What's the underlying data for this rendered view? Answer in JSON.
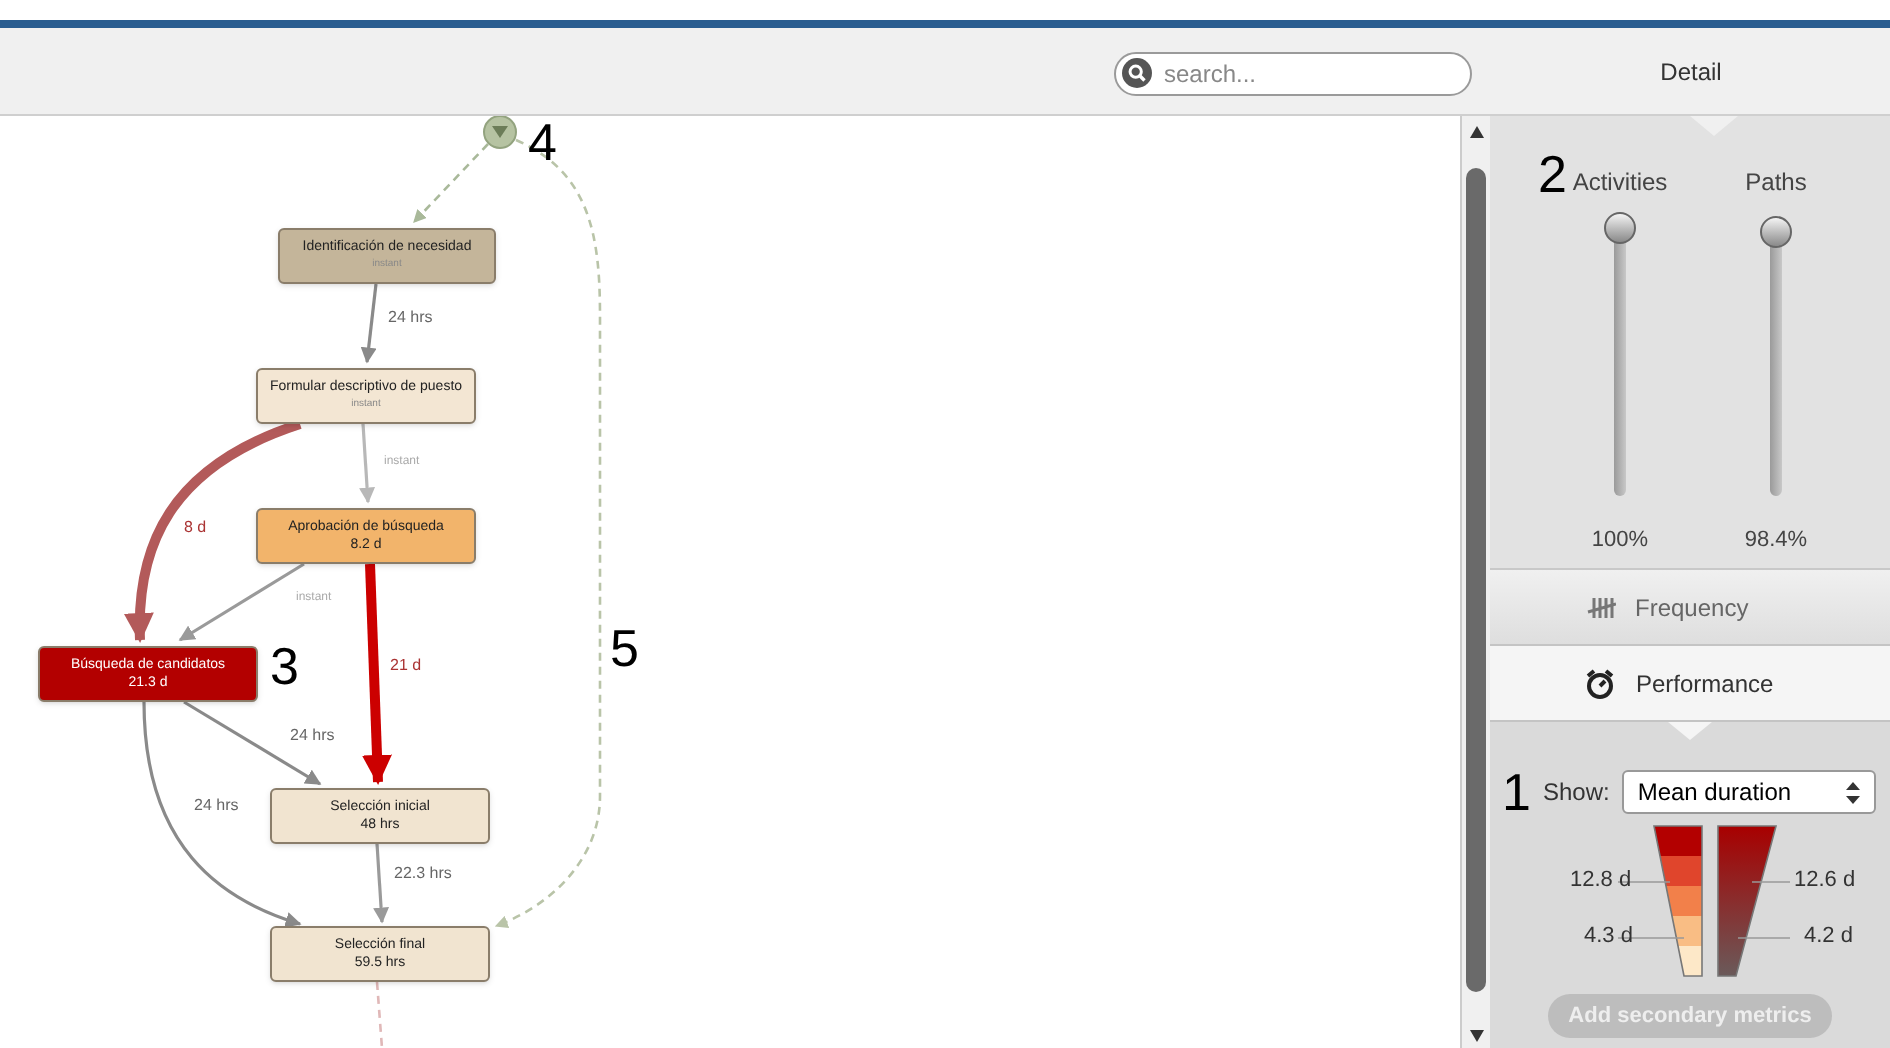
{
  "toolbar": {
    "search": {
      "placeholder": "search..."
    },
    "tabs": [
      {
        "label": "Detail",
        "selected": true
      }
    ]
  },
  "process_map": {
    "nodes": [
      {
        "name": "Identificación de necesidad",
        "metric": "instant",
        "color": "#c4b59a"
      },
      {
        "name": "Formular descriptivo de puesto",
        "metric": "instant",
        "color": "#f3e6d3"
      },
      {
        "name": "Aprobación de búsqueda",
        "metric": "8.2 d",
        "color": "#f2b46b"
      },
      {
        "name": "Búsqueda de candidatos",
        "metric": "21.3 d",
        "color": "#b30000"
      },
      {
        "name": "Selección inicial",
        "metric": "48 hrs",
        "color": "#f1e4d0"
      },
      {
        "name": "Selección final",
        "metric": "59.5 hrs",
        "color": "#f1e4d0"
      }
    ],
    "edges": [
      {
        "kind": "dashed",
        "color": "#a9b99a"
      },
      {
        "kind": "solid",
        "label": "24 hrs",
        "color": "#8a8a8a"
      },
      {
        "kind": "solid",
        "label": "instant",
        "color": "#b8b8b8"
      },
      {
        "kind": "thick",
        "label": "8 d",
        "color": "#b35a5a"
      },
      {
        "kind": "solid",
        "label": "instant",
        "color": "#9a9a9a"
      },
      {
        "kind": "thick",
        "label": "21 d",
        "color": "#cc0000"
      },
      {
        "kind": "solid",
        "label": "24 hrs",
        "color": "#8a8a8a"
      },
      {
        "kind": "solid",
        "label": "24 hrs",
        "color": "#8a8a8a"
      },
      {
        "kind": "solid",
        "label": "22.3 hrs",
        "color": "#9a9a9a"
      },
      {
        "kind": "dashed",
        "color": "#b9c4a8"
      },
      {
        "kind": "dashed",
        "color": "#e0b8b8"
      }
    ],
    "annotations": [
      "4",
      "3",
      "5"
    ]
  },
  "detail_panel": {
    "sliders": [
      {
        "label": "Activities",
        "level": 1,
        "reading": "100%"
      },
      {
        "label": "Paths",
        "level": 0.984,
        "reading": "98.4%"
      }
    ],
    "annotation_sliders": "2",
    "sections": [
      {
        "label": "Frequency",
        "kind": "frequency",
        "selected": false
      },
      {
        "label": "Performance",
        "kind": "performance",
        "selected": true
      }
    ],
    "annotation_show": "1",
    "show": {
      "label": "Show:",
      "value": "Mean duration"
    },
    "legend": {
      "left_labels": [
        "12.8 d",
        "4.3 d"
      ],
      "right_labels": [
        "12.6 d",
        "4.2 d"
      ]
    },
    "secondary_button": {
      "label": "Add secondary metrics",
      "disabled": true
    }
  }
}
